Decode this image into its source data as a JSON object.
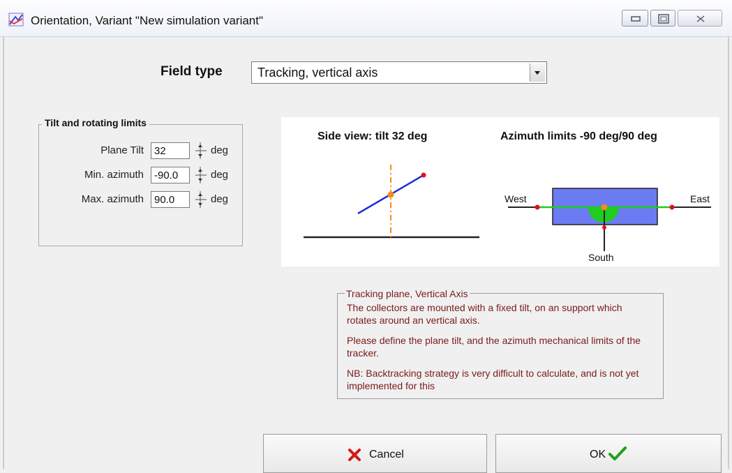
{
  "window": {
    "title": "Orientation, Variant \"New simulation variant\""
  },
  "field_type": {
    "label": "Field type",
    "selected": "Tracking, vertical axis"
  },
  "limits": {
    "group_title": "Tilt and rotating limits",
    "rows": [
      {
        "label": "Plane Tilt",
        "value": "32",
        "unit": "deg"
      },
      {
        "label": "Min. azimuth",
        "value": "-90.0",
        "unit": "deg"
      },
      {
        "label": "Max. azimuth",
        "value": "90.0",
        "unit": "deg"
      }
    ]
  },
  "diagram": {
    "side_title": "Side view: tilt 32 deg",
    "azimuth_title": "Azimuth limits -90 deg/90 deg",
    "west": "West",
    "east": "East",
    "south": "South",
    "colors": {
      "plane": "#1f2fd6",
      "axis": "#f28c1a",
      "green": "#1fcc1f",
      "red": "#e01020",
      "box": "#6b7cf2"
    }
  },
  "description": {
    "title": "Tracking plane, Vertical Axis",
    "p1": "The collectors are mounted with a fixed tilt, on an support which rotates around an vertical axis.",
    "p2": "Please define the plane tilt, and the azimuth mechanical limits of the tracker.",
    "p3": "NB: Backtracking strategy is very difficult to calculate, and is not yet implemented for this"
  },
  "buttons": {
    "cancel": "Cancel",
    "ok": "OK"
  }
}
